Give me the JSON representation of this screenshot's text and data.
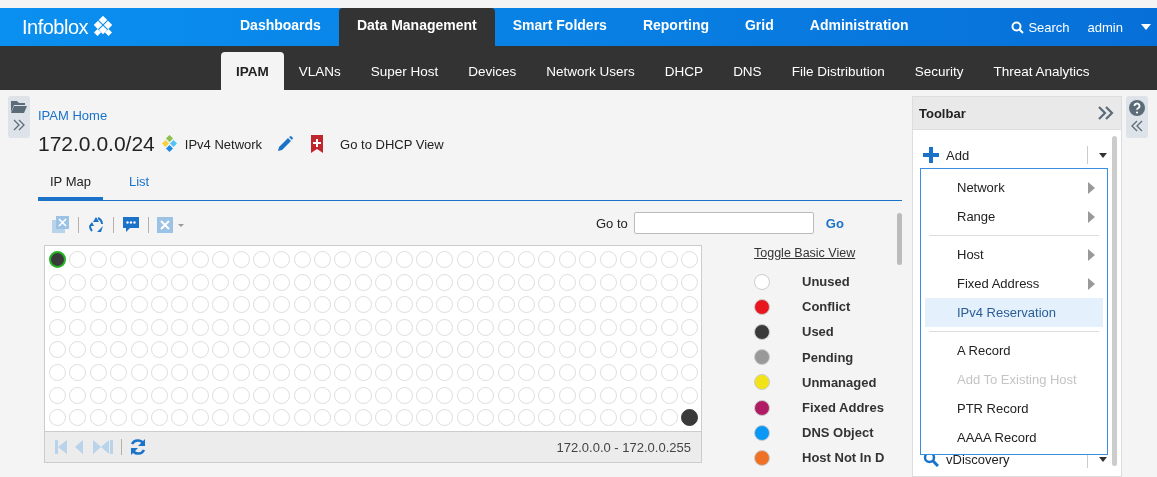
{
  "top_nav": {
    "logo": "Infoblox",
    "items": [
      {
        "label": "Dashboards",
        "selected": false
      },
      {
        "label": "Data Management",
        "selected": true
      },
      {
        "label": "Smart Folders",
        "selected": false
      },
      {
        "label": "Reporting",
        "selected": false
      },
      {
        "label": "Grid",
        "selected": false
      },
      {
        "label": "Administration",
        "selected": false
      }
    ],
    "search": "Search",
    "user": "admin"
  },
  "sub_nav": [
    {
      "label": "IPAM",
      "selected": true
    },
    {
      "label": "VLANs",
      "selected": false
    },
    {
      "label": "Super Host",
      "selected": false
    },
    {
      "label": "Devices",
      "selected": false
    },
    {
      "label": "Network Users",
      "selected": false
    },
    {
      "label": "DHCP",
      "selected": false
    },
    {
      "label": "DNS",
      "selected": false
    },
    {
      "label": "File Distribution",
      "selected": false
    },
    {
      "label": "Security",
      "selected": false
    },
    {
      "label": "Threat Analytics",
      "selected": false
    }
  ],
  "breadcrumb": "IPAM Home",
  "network": {
    "address": "172.0.0.0/24",
    "type": "IPv4 Network",
    "dhcp_link": "Go to DHCP View"
  },
  "view_tabs": [
    {
      "label": "IP Map",
      "selected": true
    },
    {
      "label": "List",
      "selected": false
    }
  ],
  "goto": {
    "label": "Go to",
    "button": "Go"
  },
  "ip_map": {
    "range": "172.0.0.0 - 172.0.0.255",
    "rows": [
      {
        "cells": [
          {
            "used": true,
            "selected": true
          },
          {
            "used": false,
            "selected": false
          },
          {
            "used": false,
            "selected": false
          },
          {
            "used": false,
            "selected": false
          },
          {
            "used": false,
            "selected": false
          },
          {
            "used": false,
            "selected": false
          },
          {
            "used": false,
            "selected": false
          },
          {
            "used": false,
            "selected": false
          },
          {
            "used": false,
            "selected": false
          },
          {
            "used": false,
            "selected": false
          },
          {
            "used": false,
            "selected": false
          },
          {
            "used": false,
            "selected": false
          },
          {
            "used": false,
            "selected": false
          },
          {
            "used": false,
            "selected": false
          },
          {
            "used": false,
            "selected": false
          },
          {
            "used": false,
            "selected": false
          },
          {
            "used": false,
            "selected": false
          },
          {
            "used": false,
            "selected": false
          },
          {
            "used": false,
            "selected": false
          },
          {
            "used": false,
            "selected": false
          },
          {
            "used": false,
            "selected": false
          },
          {
            "used": false,
            "selected": false
          },
          {
            "used": false,
            "selected": false
          },
          {
            "used": false,
            "selected": false
          },
          {
            "used": false,
            "selected": false
          },
          {
            "used": false,
            "selected": false
          },
          {
            "used": false,
            "selected": false
          },
          {
            "used": false,
            "selected": false
          },
          {
            "used": false,
            "selected": false
          },
          {
            "used": false,
            "selected": false
          },
          {
            "used": false,
            "selected": false
          },
          {
            "used": false,
            "selected": false
          }
        ]
      },
      {
        "cells": [
          {
            "used": false,
            "selected": false
          },
          {
            "used": false,
            "selected": false
          },
          {
            "used": false,
            "selected": false
          },
          {
            "used": false,
            "selected": false
          },
          {
            "used": false,
            "selected": false
          },
          {
            "used": false,
            "selected": false
          },
          {
            "used": false,
            "selected": false
          },
          {
            "used": false,
            "selected": false
          },
          {
            "used": false,
            "selected": false
          },
          {
            "used": false,
            "selected": false
          },
          {
            "used": false,
            "selected": false
          },
          {
            "used": false,
            "selected": false
          },
          {
            "used": false,
            "selected": false
          },
          {
            "used": false,
            "selected": false
          },
          {
            "used": false,
            "selected": false
          },
          {
            "used": false,
            "selected": false
          },
          {
            "used": false,
            "selected": false
          },
          {
            "used": false,
            "selected": false
          },
          {
            "used": false,
            "selected": false
          },
          {
            "used": false,
            "selected": false
          },
          {
            "used": false,
            "selected": false
          },
          {
            "used": false,
            "selected": false
          },
          {
            "used": false,
            "selected": false
          },
          {
            "used": false,
            "selected": false
          },
          {
            "used": false,
            "selected": false
          },
          {
            "used": false,
            "selected": false
          },
          {
            "used": false,
            "selected": false
          },
          {
            "used": false,
            "selected": false
          },
          {
            "used": false,
            "selected": false
          },
          {
            "used": false,
            "selected": false
          },
          {
            "used": false,
            "selected": false
          },
          {
            "used": false,
            "selected": false
          }
        ]
      },
      {
        "cells": [
          {
            "used": false,
            "selected": false
          },
          {
            "used": false,
            "selected": false
          },
          {
            "used": false,
            "selected": false
          },
          {
            "used": false,
            "selected": false
          },
          {
            "used": false,
            "selected": false
          },
          {
            "used": false,
            "selected": false
          },
          {
            "used": false,
            "selected": false
          },
          {
            "used": false,
            "selected": false
          },
          {
            "used": false,
            "selected": false
          },
          {
            "used": false,
            "selected": false
          },
          {
            "used": false,
            "selected": false
          },
          {
            "used": false,
            "selected": false
          },
          {
            "used": false,
            "selected": false
          },
          {
            "used": false,
            "selected": false
          },
          {
            "used": false,
            "selected": false
          },
          {
            "used": false,
            "selected": false
          },
          {
            "used": false,
            "selected": false
          },
          {
            "used": false,
            "selected": false
          },
          {
            "used": false,
            "selected": false
          },
          {
            "used": false,
            "selected": false
          },
          {
            "used": false,
            "selected": false
          },
          {
            "used": false,
            "selected": false
          },
          {
            "used": false,
            "selected": false
          },
          {
            "used": false,
            "selected": false
          },
          {
            "used": false,
            "selected": false
          },
          {
            "used": false,
            "selected": false
          },
          {
            "used": false,
            "selected": false
          },
          {
            "used": false,
            "selected": false
          },
          {
            "used": false,
            "selected": false
          },
          {
            "used": false,
            "selected": false
          },
          {
            "used": false,
            "selected": false
          },
          {
            "used": false,
            "selected": false
          }
        ]
      },
      {
        "cells": [
          {
            "used": false,
            "selected": false
          },
          {
            "used": false,
            "selected": false
          },
          {
            "used": false,
            "selected": false
          },
          {
            "used": false,
            "selected": false
          },
          {
            "used": false,
            "selected": false
          },
          {
            "used": false,
            "selected": false
          },
          {
            "used": false,
            "selected": false
          },
          {
            "used": false,
            "selected": false
          },
          {
            "used": false,
            "selected": false
          },
          {
            "used": false,
            "selected": false
          },
          {
            "used": false,
            "selected": false
          },
          {
            "used": false,
            "selected": false
          },
          {
            "used": false,
            "selected": false
          },
          {
            "used": false,
            "selected": false
          },
          {
            "used": false,
            "selected": false
          },
          {
            "used": false,
            "selected": false
          },
          {
            "used": false,
            "selected": false
          },
          {
            "used": false,
            "selected": false
          },
          {
            "used": false,
            "selected": false
          },
          {
            "used": false,
            "selected": false
          },
          {
            "used": false,
            "selected": false
          },
          {
            "used": false,
            "selected": false
          },
          {
            "used": false,
            "selected": false
          },
          {
            "used": false,
            "selected": false
          },
          {
            "used": false,
            "selected": false
          },
          {
            "used": false,
            "selected": false
          },
          {
            "used": false,
            "selected": false
          },
          {
            "used": false,
            "selected": false
          },
          {
            "used": false,
            "selected": false
          },
          {
            "used": false,
            "selected": false
          },
          {
            "used": false,
            "selected": false
          },
          {
            "used": false,
            "selected": false
          }
        ]
      },
      {
        "cells": [
          {
            "used": false,
            "selected": false
          },
          {
            "used": false,
            "selected": false
          },
          {
            "used": false,
            "selected": false
          },
          {
            "used": false,
            "selected": false
          },
          {
            "used": false,
            "selected": false
          },
          {
            "used": false,
            "selected": false
          },
          {
            "used": false,
            "selected": false
          },
          {
            "used": false,
            "selected": false
          },
          {
            "used": false,
            "selected": false
          },
          {
            "used": false,
            "selected": false
          },
          {
            "used": false,
            "selected": false
          },
          {
            "used": false,
            "selected": false
          },
          {
            "used": false,
            "selected": false
          },
          {
            "used": false,
            "selected": false
          },
          {
            "used": false,
            "selected": false
          },
          {
            "used": false,
            "selected": false
          },
          {
            "used": false,
            "selected": false
          },
          {
            "used": false,
            "selected": false
          },
          {
            "used": false,
            "selected": false
          },
          {
            "used": false,
            "selected": false
          },
          {
            "used": false,
            "selected": false
          },
          {
            "used": false,
            "selected": false
          },
          {
            "used": false,
            "selected": false
          },
          {
            "used": false,
            "selected": false
          },
          {
            "used": false,
            "selected": false
          },
          {
            "used": false,
            "selected": false
          },
          {
            "used": false,
            "selected": false
          },
          {
            "used": false,
            "selected": false
          },
          {
            "used": false,
            "selected": false
          },
          {
            "used": false,
            "selected": false
          },
          {
            "used": false,
            "selected": false
          },
          {
            "used": false,
            "selected": false
          }
        ]
      },
      {
        "cells": [
          {
            "used": false,
            "selected": false
          },
          {
            "used": false,
            "selected": false
          },
          {
            "used": false,
            "selected": false
          },
          {
            "used": false,
            "selected": false
          },
          {
            "used": false,
            "selected": false
          },
          {
            "used": false,
            "selected": false
          },
          {
            "used": false,
            "selected": false
          },
          {
            "used": false,
            "selected": false
          },
          {
            "used": false,
            "selected": false
          },
          {
            "used": false,
            "selected": false
          },
          {
            "used": false,
            "selected": false
          },
          {
            "used": false,
            "selected": false
          },
          {
            "used": false,
            "selected": false
          },
          {
            "used": false,
            "selected": false
          },
          {
            "used": false,
            "selected": false
          },
          {
            "used": false,
            "selected": false
          },
          {
            "used": false,
            "selected": false
          },
          {
            "used": false,
            "selected": false
          },
          {
            "used": false,
            "selected": false
          },
          {
            "used": false,
            "selected": false
          },
          {
            "used": false,
            "selected": false
          },
          {
            "used": false,
            "selected": false
          },
          {
            "used": false,
            "selected": false
          },
          {
            "used": false,
            "selected": false
          },
          {
            "used": false,
            "selected": false
          },
          {
            "used": false,
            "selected": false
          },
          {
            "used": false,
            "selected": false
          },
          {
            "used": false,
            "selected": false
          },
          {
            "used": false,
            "selected": false
          },
          {
            "used": false,
            "selected": false
          },
          {
            "used": false,
            "selected": false
          },
          {
            "used": false,
            "selected": false
          }
        ]
      },
      {
        "cells": [
          {
            "used": false,
            "selected": false
          },
          {
            "used": false,
            "selected": false
          },
          {
            "used": false,
            "selected": false
          },
          {
            "used": false,
            "selected": false
          },
          {
            "used": false,
            "selected": false
          },
          {
            "used": false,
            "selected": false
          },
          {
            "used": false,
            "selected": false
          },
          {
            "used": false,
            "selected": false
          },
          {
            "used": false,
            "selected": false
          },
          {
            "used": false,
            "selected": false
          },
          {
            "used": false,
            "selected": false
          },
          {
            "used": false,
            "selected": false
          },
          {
            "used": false,
            "selected": false
          },
          {
            "used": false,
            "selected": false
          },
          {
            "used": false,
            "selected": false
          },
          {
            "used": false,
            "selected": false
          },
          {
            "used": false,
            "selected": false
          },
          {
            "used": false,
            "selected": false
          },
          {
            "used": false,
            "selected": false
          },
          {
            "used": false,
            "selected": false
          },
          {
            "used": false,
            "selected": false
          },
          {
            "used": false,
            "selected": false
          },
          {
            "used": false,
            "selected": false
          },
          {
            "used": false,
            "selected": false
          },
          {
            "used": false,
            "selected": false
          },
          {
            "used": false,
            "selected": false
          },
          {
            "used": false,
            "selected": false
          },
          {
            "used": false,
            "selected": false
          },
          {
            "used": false,
            "selected": false
          },
          {
            "used": false,
            "selected": false
          },
          {
            "used": false,
            "selected": false
          },
          {
            "used": false,
            "selected": false
          }
        ]
      },
      {
        "cells": [
          {
            "used": false,
            "selected": false
          },
          {
            "used": false,
            "selected": false
          },
          {
            "used": false,
            "selected": false
          },
          {
            "used": false,
            "selected": false
          },
          {
            "used": false,
            "selected": false
          },
          {
            "used": false,
            "selected": false
          },
          {
            "used": false,
            "selected": false
          },
          {
            "used": false,
            "selected": false
          },
          {
            "used": false,
            "selected": false
          },
          {
            "used": false,
            "selected": false
          },
          {
            "used": false,
            "selected": false
          },
          {
            "used": false,
            "selected": false
          },
          {
            "used": false,
            "selected": false
          },
          {
            "used": false,
            "selected": false
          },
          {
            "used": false,
            "selected": false
          },
          {
            "used": false,
            "selected": false
          },
          {
            "used": false,
            "selected": false
          },
          {
            "used": false,
            "selected": false
          },
          {
            "used": false,
            "selected": false
          },
          {
            "used": false,
            "selected": false
          },
          {
            "used": false,
            "selected": false
          },
          {
            "used": false,
            "selected": false
          },
          {
            "used": false,
            "selected": false
          },
          {
            "used": false,
            "selected": false
          },
          {
            "used": false,
            "selected": false
          },
          {
            "used": false,
            "selected": false
          },
          {
            "used": false,
            "selected": false
          },
          {
            "used": false,
            "selected": false
          },
          {
            "used": false,
            "selected": false
          },
          {
            "used": false,
            "selected": false
          },
          {
            "used": false,
            "selected": false
          },
          {
            "used": true,
            "selected": false
          }
        ]
      }
    ]
  },
  "legend": {
    "toggle": "Toggle Basic View",
    "items": [
      {
        "label": "Unused",
        "color": "#ffffff"
      },
      {
        "label": "Conflict",
        "color": "#e8161f"
      },
      {
        "label": "Used",
        "color": "#3a3a3a"
      },
      {
        "label": "Pending",
        "color": "#999999"
      },
      {
        "label": "Unmanaged",
        "color": "#f2e318"
      },
      {
        "label": "Fixed Addres",
        "color": "#b01b65"
      },
      {
        "label": "DNS Object",
        "color": "#0a97f5"
      },
      {
        "label": "Host Not In D",
        "color": "#ef7125"
      }
    ]
  },
  "toolbar": {
    "title": "Toolbar",
    "add": "Add",
    "discovery": "vDiscovery",
    "menu": [
      {
        "kind": "item",
        "label": "Network",
        "submenu": true,
        "selected": false,
        "disabled": false
      },
      {
        "kind": "item",
        "label": "Range",
        "submenu": true,
        "selected": false,
        "disabled": false
      },
      {
        "kind": "separator"
      },
      {
        "kind": "item",
        "label": "Host",
        "submenu": true,
        "selected": false,
        "disabled": false
      },
      {
        "kind": "item",
        "label": "Fixed Address",
        "submenu": true,
        "selected": false,
        "disabled": false
      },
      {
        "kind": "item",
        "label": "IPv4 Reservation",
        "submenu": false,
        "selected": true,
        "disabled": false
      },
      {
        "kind": "separator"
      },
      {
        "kind": "item",
        "label": "A Record",
        "submenu": false,
        "selected": false,
        "disabled": false
      },
      {
        "kind": "item",
        "label": "Add To Existing Host",
        "submenu": false,
        "selected": false,
        "disabled": true
      },
      {
        "kind": "item",
        "label": "PTR Record",
        "submenu": false,
        "selected": false,
        "disabled": false
      },
      {
        "kind": "item",
        "label": "AAAA Record",
        "submenu": false,
        "selected": false,
        "disabled": false
      }
    ]
  }
}
